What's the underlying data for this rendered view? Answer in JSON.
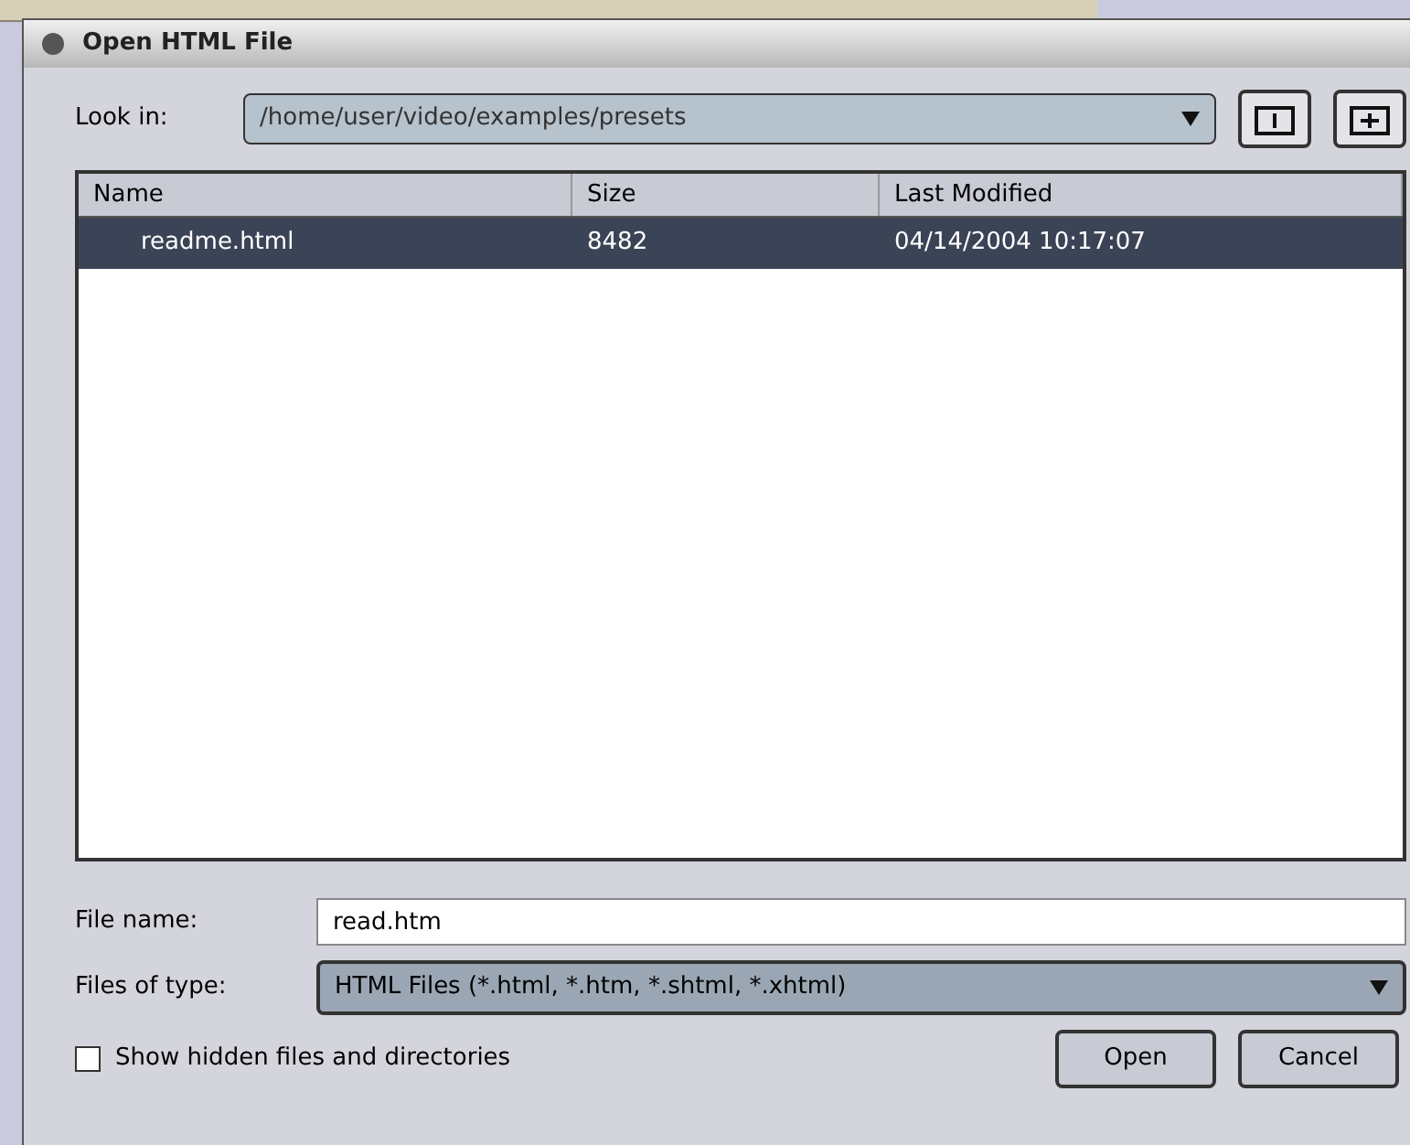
{
  "window": {
    "title": "Open HTML File"
  },
  "look_in": {
    "label": "Look in:",
    "value": "/home/user/video/examples/presets"
  },
  "table": {
    "columns": [
      "Name",
      "Size",
      "Last Modified"
    ],
    "rows": [
      {
        "cells": [
          "readme.html",
          "8482",
          "04/14/2004 10:17:07"
        ],
        "selected": true
      }
    ]
  },
  "file_name": {
    "label": "File name:",
    "value": "read.htm"
  },
  "file_type": {
    "label": "Files of type:",
    "value": "HTML Files (*.html, *.htm, *.shtml, *.xhtml)"
  },
  "show_hidden": {
    "label": "Show hidden files and directories",
    "checked": false
  },
  "buttons": [
    "Open",
    "Cancel"
  ]
}
